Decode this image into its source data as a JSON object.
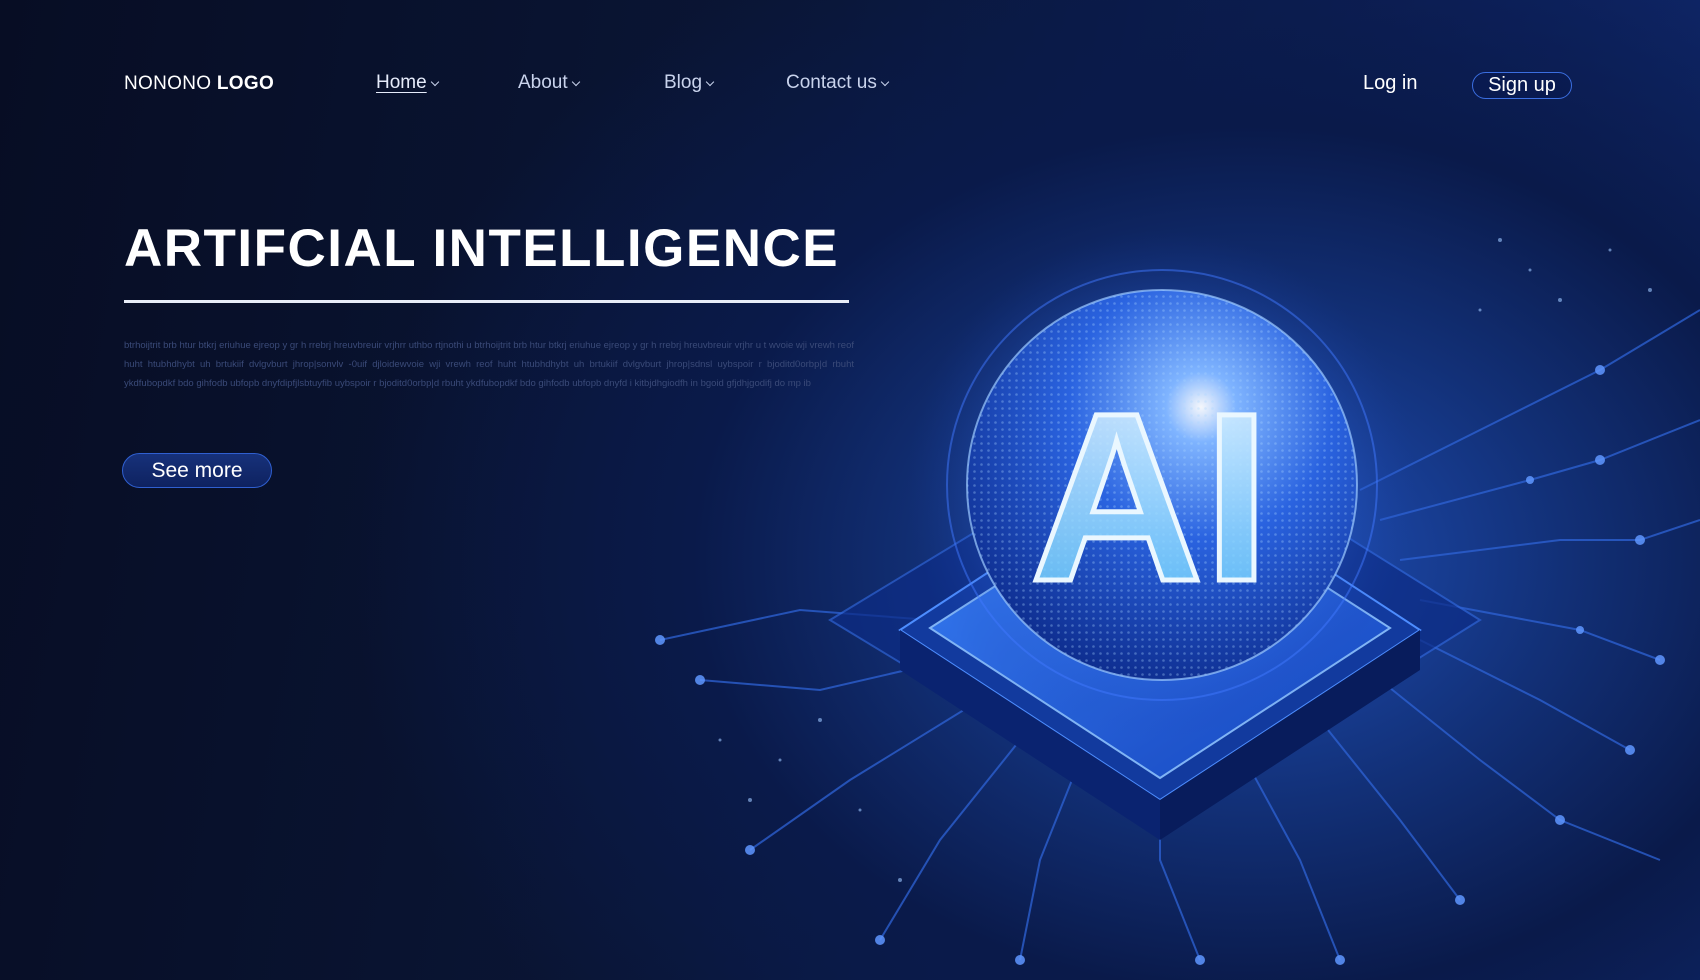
{
  "header": {
    "logo_regular": "NONONO",
    "logo_bold": "LOGO",
    "nav": [
      {
        "label": "Home",
        "active": true
      },
      {
        "label": "About",
        "active": false
      },
      {
        "label": "Blog",
        "active": false
      },
      {
        "label": "Contact us",
        "active": false
      }
    ],
    "login_label": "Log in",
    "signup_label": "Sign up"
  },
  "hero": {
    "title": "ARTIFCIAL INTELLIGENCE",
    "body": "btrhoijtrit brb htur btkrj  eriuhue ejreop y gr h rrebrj hreuvbreuir  vrjhrr uthbo rtjnothi u  btrhoijtrit brb htur btkrj  eriuhue ejreop y gr h rrebrj hreuvbreuir  vrjhr u t wvoie wji vrewh reof huht htubhdhybt uh brtukiif dvlgvburt  jhrop|sonvlv -0uif djloidewvoie wji vrewh reof huht htubhdhybt uh brtukiif dvlgvburt  jhrop|sdnsl uybspoir r bjoditd0orbp|d rbuht ykdfubopdkf bdo gihfodb ubfopb dnyfdipfjlsbtuyfib uybspoir r bjoditd0orbp|d rbuht ykdfubopdkf bdo gihfodb ubfopb dnyfd i kitbjdhgiodfh in bgoid gfjdhjgodifj do mp ib",
    "cta_label": "See more"
  },
  "illustration": {
    "glyph_text": "AI"
  },
  "colors": {
    "background_dark": "#070d24",
    "background_glow": "#1f4fb8",
    "accent": "#3b6ee0",
    "text_primary": "#ffffff",
    "text_nav": "#c9d3ec",
    "body_text": "#3a4a78"
  }
}
